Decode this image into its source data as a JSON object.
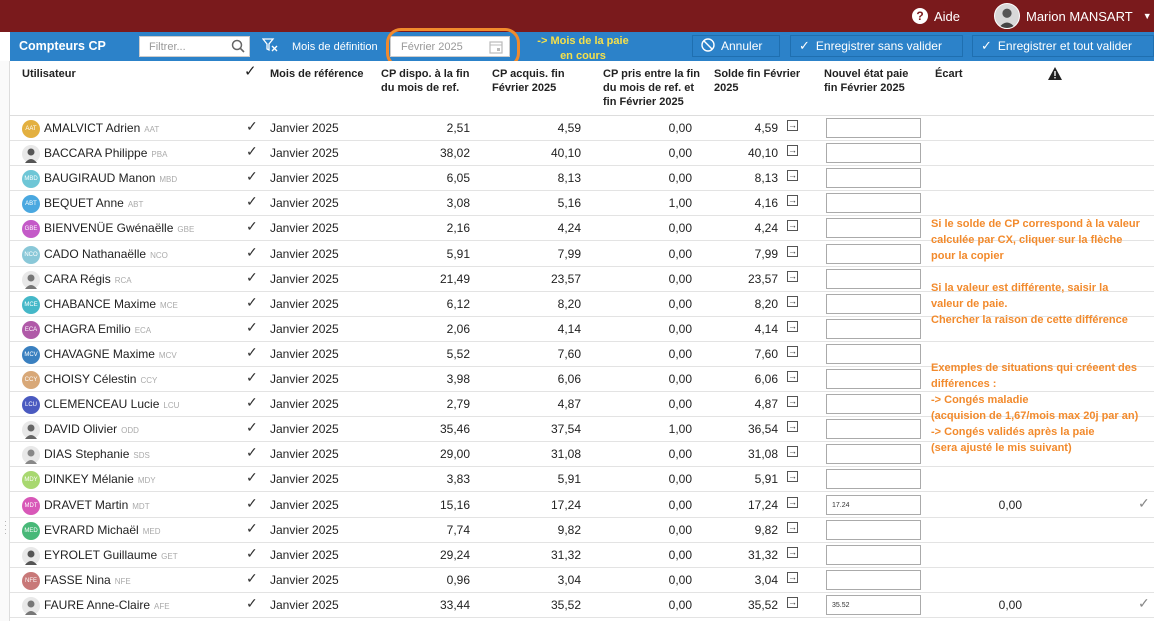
{
  "header": {
    "help_label": "Aide",
    "user_name": "Marion MANSART"
  },
  "toolbar": {
    "title": "Compteurs CP",
    "filter_placeholder": "Filtrer...",
    "mois_label": "Mois de définition",
    "date_value": "Février 2025",
    "annotation_line1": "-> Mois de la paie",
    "annotation_line2": "en cours",
    "btn_annuler": "Annuler",
    "btn_sans_valider": "Enregistrer sans valider",
    "btn_tout_valider": "Enregistrer et tout valider"
  },
  "columns": {
    "utilisateur": "Utilisateur",
    "mois_ref": "Mois de référence",
    "cp_dispo_1": "CP dispo. à la fin",
    "cp_dispo_2": "du mois de ref.",
    "cp_acquis_1": "CP acquis. fin",
    "cp_acquis_2": "Février 2025",
    "cp_pris_1": "CP pris entre la fin",
    "cp_pris_2": "du mois de ref. et",
    "cp_pris_3": "fin Février 2025",
    "solde_1": "Solde fin Février",
    "solde_2": "2025",
    "nouvel_1": "Nouvel état paie",
    "nouvel_2": "fin Février 2025",
    "ecart": "Écart"
  },
  "colors": {
    "topbar": "#7a1a1c",
    "toolbar": "#2c82c9",
    "annotation": "#f28a2c"
  },
  "rows": [
    {
      "name": "AMALVICT Adrien",
      "code": "AAT",
      "mois": "Janvier 2025",
      "dispo": "2,51",
      "acquis": "4,59",
      "pris": "0,00",
      "solde": "4,59",
      "nouvel": "",
      "ecart": "",
      "color": "#e3b040",
      "photo": false
    },
    {
      "name": "BACCARA Philippe",
      "code": "PBA",
      "mois": "Janvier 2025",
      "dispo": "38,02",
      "acquis": "40,10",
      "pris": "0,00",
      "solde": "40,10",
      "nouvel": "",
      "ecart": "",
      "color": "#555",
      "photo": true
    },
    {
      "name": "BAUGIRAUD Manon",
      "code": "MBD",
      "mois": "Janvier 2025",
      "dispo": "6,05",
      "acquis": "8,13",
      "pris": "0,00",
      "solde": "8,13",
      "nouvel": "",
      "ecart": "",
      "color": "#6ec6d6",
      "photo": false
    },
    {
      "name": "BEQUET Anne",
      "code": "ABT",
      "mois": "Janvier 2025",
      "dispo": "3,08",
      "acquis": "5,16",
      "pris": "1,00",
      "solde": "4,16",
      "nouvel": "",
      "ecart": "",
      "color": "#4aa8e0",
      "photo": false
    },
    {
      "name": "BIENVENÜE Gwénaëlle",
      "code": "GBE",
      "mois": "Janvier 2025",
      "dispo": "2,16",
      "acquis": "4,24",
      "pris": "0,00",
      "solde": "4,24",
      "nouvel": "",
      "ecart": "",
      "color": "#c45ac8",
      "photo": false
    },
    {
      "name": "CADO Nathanaëlle",
      "code": "NCO",
      "mois": "Janvier 2025",
      "dispo": "5,91",
      "acquis": "7,99",
      "pris": "0,00",
      "solde": "7,99",
      "nouvel": "",
      "ecart": "",
      "color": "#8ac8d8",
      "photo": false
    },
    {
      "name": "CARA Régis",
      "code": "RCA",
      "mois": "Janvier 2025",
      "dispo": "21,49",
      "acquis": "23,57",
      "pris": "0,00",
      "solde": "23,57",
      "nouvel": "",
      "ecart": "",
      "color": "#777",
      "photo": true
    },
    {
      "name": "CHABANCE Maxime",
      "code": "MCE",
      "mois": "Janvier 2025",
      "dispo": "6,12",
      "acquis": "8,20",
      "pris": "0,00",
      "solde": "8,20",
      "nouvel": "",
      "ecart": "",
      "color": "#45b8c8",
      "photo": false
    },
    {
      "name": "CHAGRA Emilio",
      "code": "ECA",
      "mois": "Janvier 2025",
      "dispo": "2,06",
      "acquis": "4,14",
      "pris": "0,00",
      "solde": "4,14",
      "nouvel": "",
      "ecart": "",
      "color": "#b05aa8",
      "photo": false
    },
    {
      "name": "CHAVAGNE Maxime",
      "code": "MCV",
      "mois": "Janvier 2025",
      "dispo": "5,52",
      "acquis": "7,60",
      "pris": "0,00",
      "solde": "7,60",
      "nouvel": "",
      "ecart": "",
      "color": "#3a80c0",
      "photo": false
    },
    {
      "name": "CHOISY Célestin",
      "code": "CCY",
      "mois": "Janvier 2025",
      "dispo": "3,98",
      "acquis": "6,06",
      "pris": "0,00",
      "solde": "6,06",
      "nouvel": "",
      "ecart": "",
      "color": "#d8a878",
      "photo": false
    },
    {
      "name": "CLEMENCEAU Lucie",
      "code": "LCU",
      "mois": "Janvier 2025",
      "dispo": "2,79",
      "acquis": "4,87",
      "pris": "0,00",
      "solde": "4,87",
      "nouvel": "",
      "ecart": "",
      "color": "#4a5ac0",
      "photo": false
    },
    {
      "name": "DAVID Olivier",
      "code": "ODD",
      "mois": "Janvier 2025",
      "dispo": "35,46",
      "acquis": "37,54",
      "pris": "1,00",
      "solde": "36,54",
      "nouvel": "",
      "ecart": "",
      "color": "#666",
      "photo": true
    },
    {
      "name": "DIAS Stephanie",
      "code": "SDS",
      "mois": "Janvier 2025",
      "dispo": "29,00",
      "acquis": "31,08",
      "pris": "0,00",
      "solde": "31,08",
      "nouvel": "",
      "ecart": "",
      "color": "#888",
      "photo": true
    },
    {
      "name": "DINKEY Mélanie",
      "code": "MDY",
      "mois": "Janvier 2025",
      "dispo": "3,83",
      "acquis": "5,91",
      "pris": "0,00",
      "solde": "5,91",
      "nouvel": "",
      "ecart": "",
      "color": "#a8d870",
      "photo": false
    },
    {
      "name": "DRAVET Martin",
      "code": "MDT",
      "mois": "Janvier 2025",
      "dispo": "15,16",
      "acquis": "17,24",
      "pris": "0,00",
      "solde": "17,24",
      "nouvel": "17.24",
      "ecart": "0,00",
      "color": "#d858b8",
      "photo": false
    },
    {
      "name": "EVRARD Michaël",
      "code": "MED",
      "mois": "Janvier 2025",
      "dispo": "7,74",
      "acquis": "9,82",
      "pris": "0,00",
      "solde": "9,82",
      "nouvel": "",
      "ecart": "",
      "color": "#48b878",
      "photo": false
    },
    {
      "name": "EYROLET Guillaume",
      "code": "GET",
      "mois": "Janvier 2025",
      "dispo": "29,24",
      "acquis": "31,32",
      "pris": "0,00",
      "solde": "31,32",
      "nouvel": "",
      "ecart": "",
      "color": "#555",
      "photo": true
    },
    {
      "name": "FASSE Nina",
      "code": "NFE",
      "mois": "Janvier 2025",
      "dispo": "0,96",
      "acquis": "3,04",
      "pris": "0,00",
      "solde": "3,04",
      "nouvel": "",
      "ecart": "",
      "color": "#c87878",
      "photo": false
    },
    {
      "name": "FAURE Anne-Claire",
      "code": "AFE",
      "mois": "Janvier 2025",
      "dispo": "33,44",
      "acquis": "35,52",
      "pris": "0,00",
      "solde": "35,52",
      "nouvel": "35.52",
      "ecart": "0,00",
      "color": "#777",
      "photo": true
    }
  ],
  "notes": {
    "n1": [
      "Si le solde de CP correspond à la valeur",
      "calculée par CX, cliquer sur la flèche",
      "pour la copier"
    ],
    "n2": [
      "Si la valeur est différente, saisir la",
      "valeur de paie.",
      "Chercher la raison de cette différence"
    ],
    "n3": [
      "Exemples de situations qui créeent des",
      "différences :",
      "-> Congés maladie",
      "(acquision de 1,67/mois max 20j par an)",
      "-> Congés validés après la paie",
      "(sera ajusté le mis suivant)"
    ]
  }
}
